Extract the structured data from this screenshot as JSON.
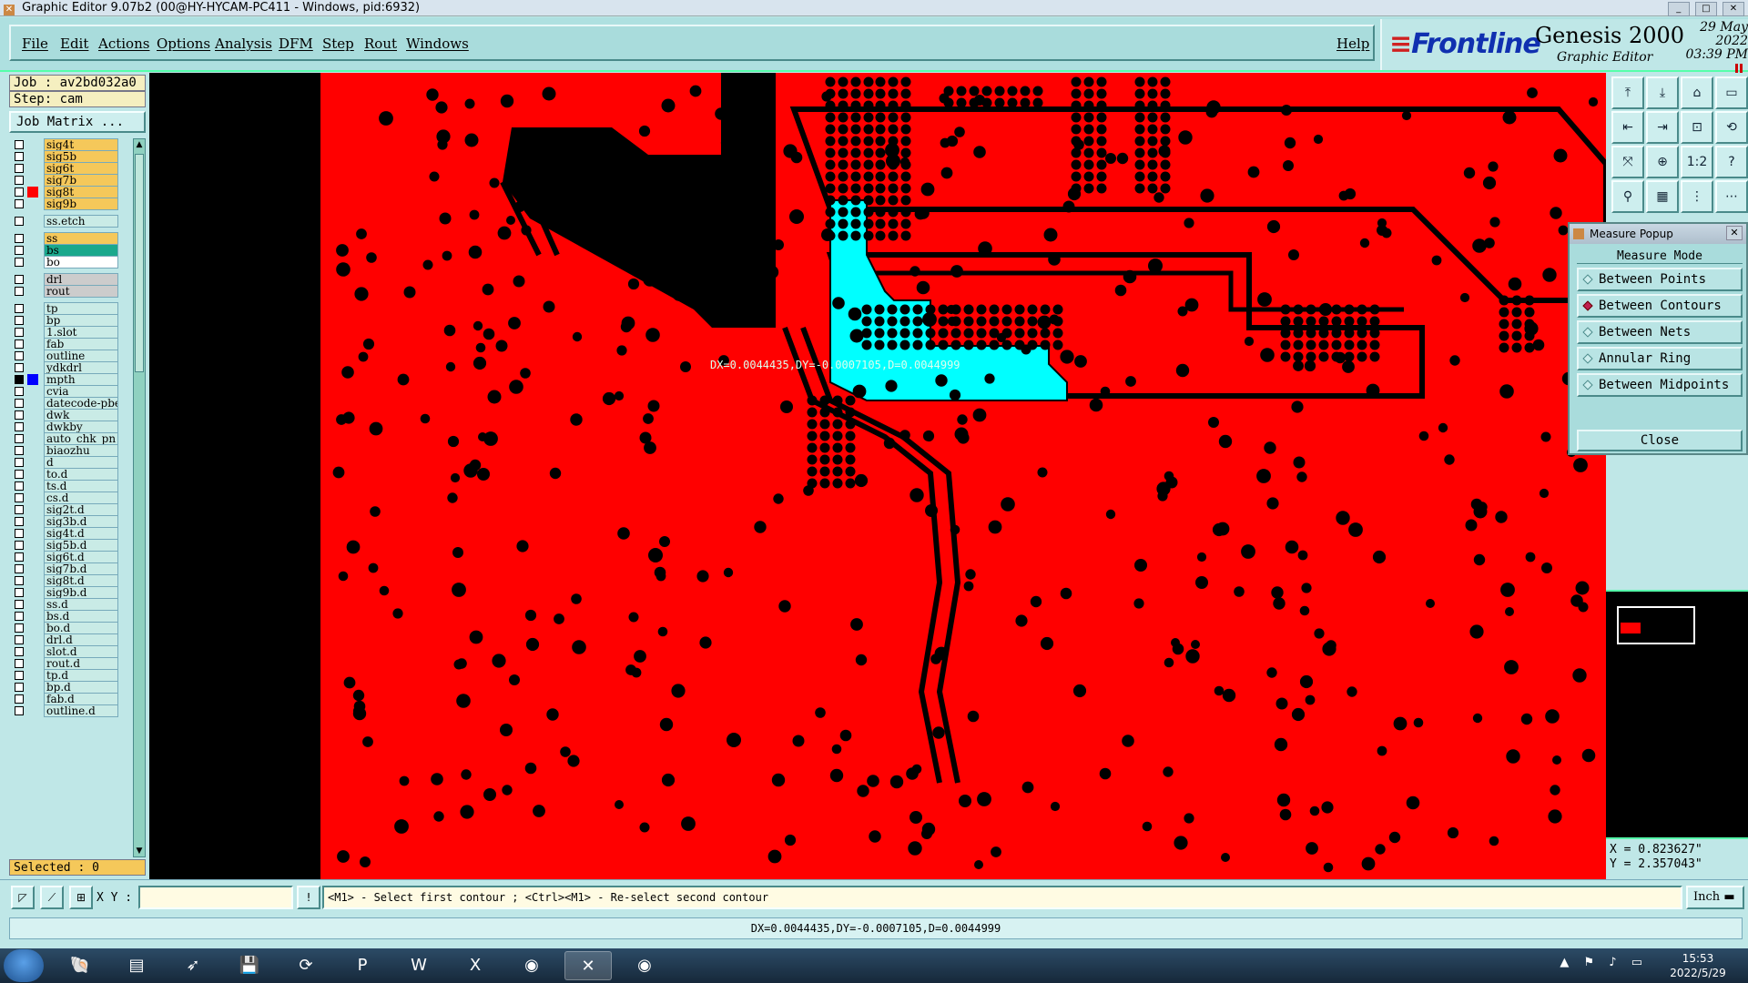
{
  "window": {
    "title": "Graphic Editor 9.07b2 (00@HY-HYCAM-PC411 - Windows, pid:6932)",
    "controls": [
      "_",
      "□",
      "✕"
    ]
  },
  "menu": {
    "items": [
      "File",
      "Edit",
      "Actions",
      "Options",
      "Analysis",
      "DFM",
      "Step",
      "Rout",
      "Windows"
    ],
    "help": "Help"
  },
  "brand": {
    "logo": "Frontline",
    "product": "Genesis 2000",
    "subtitle": "Graphic Editor",
    "date": "29 May 2022",
    "time": "03:39 PM"
  },
  "left_panel": {
    "job": "Job : av2bd032a0",
    "step": "Step: cam",
    "job_matrix": "Job Matrix ...",
    "selected": "Selected : 0"
  },
  "layers": [
    {
      "name": "sig4t",
      "style": "sig",
      "swatch": ""
    },
    {
      "name": "sig5b",
      "style": "sig",
      "swatch": ""
    },
    {
      "name": "sig6t",
      "style": "sig",
      "swatch": ""
    },
    {
      "name": "sig7b",
      "style": "sig",
      "swatch": ""
    },
    {
      "name": "sig8t",
      "style": "sig",
      "swatch": "#ff0000"
    },
    {
      "name": "sig9b",
      "style": "sig",
      "swatch": ""
    },
    {
      "name": "ss.etch",
      "style": "plain",
      "swatch": "",
      "gap": true
    },
    {
      "name": "ss",
      "style": "sig",
      "swatch": "",
      "gap": true
    },
    {
      "name": "bs",
      "style": "teal",
      "swatch": ""
    },
    {
      "name": "bo",
      "style": "white",
      "swatch": ""
    },
    {
      "name": "drl",
      "style": "grey",
      "swatch": "",
      "gap": true
    },
    {
      "name": "rout",
      "style": "grey",
      "swatch": ""
    },
    {
      "name": "tp",
      "style": "plain",
      "swatch": "",
      "gap": true
    },
    {
      "name": "bp",
      "style": "plain",
      "swatch": ""
    },
    {
      "name": "1.slot",
      "style": "plain",
      "swatch": ""
    },
    {
      "name": "fab",
      "style": "plain",
      "swatch": ""
    },
    {
      "name": "outline",
      "style": "plain",
      "swatch": ""
    },
    {
      "name": "ydkdrl",
      "style": "plain",
      "swatch": ""
    },
    {
      "name": "mpth",
      "style": "plain",
      "swatch": "#0000ff",
      "checked": true
    },
    {
      "name": "cvia",
      "style": "plain",
      "swatch": ""
    },
    {
      "name": "datecode-pbe",
      "style": "plain",
      "swatch": ""
    },
    {
      "name": "dwk",
      "style": "plain",
      "swatch": ""
    },
    {
      "name": "dwkby",
      "style": "plain",
      "swatch": ""
    },
    {
      "name": "auto_chk_pn",
      "style": "plain",
      "swatch": ""
    },
    {
      "name": "biaozhu",
      "style": "plain",
      "swatch": ""
    },
    {
      "name": "d",
      "style": "plain",
      "swatch": ""
    },
    {
      "name": "to.d",
      "style": "plain",
      "swatch": ""
    },
    {
      "name": "ts.d",
      "style": "plain",
      "swatch": ""
    },
    {
      "name": "cs.d",
      "style": "plain",
      "swatch": ""
    },
    {
      "name": "sig2t.d",
      "style": "plain",
      "swatch": ""
    },
    {
      "name": "sig3b.d",
      "style": "plain",
      "swatch": ""
    },
    {
      "name": "sig4t.d",
      "style": "plain",
      "swatch": ""
    },
    {
      "name": "sig5b.d",
      "style": "plain",
      "swatch": ""
    },
    {
      "name": "sig6t.d",
      "style": "plain",
      "swatch": ""
    },
    {
      "name": "sig7b.d",
      "style": "plain",
      "swatch": ""
    },
    {
      "name": "sig8t.d",
      "style": "plain",
      "swatch": ""
    },
    {
      "name": "sig9b.d",
      "style": "plain",
      "swatch": ""
    },
    {
      "name": "ss.d",
      "style": "plain",
      "swatch": ""
    },
    {
      "name": "bs.d",
      "style": "plain",
      "swatch": ""
    },
    {
      "name": "bo.d",
      "style": "plain",
      "swatch": ""
    },
    {
      "name": "drl.d",
      "style": "plain",
      "swatch": ""
    },
    {
      "name": "slot.d",
      "style": "plain",
      "swatch": ""
    },
    {
      "name": "rout.d",
      "style": "plain",
      "swatch": ""
    },
    {
      "name": "tp.d",
      "style": "plain",
      "swatch": ""
    },
    {
      "name": "bp.d",
      "style": "plain",
      "swatch": ""
    },
    {
      "name": "fab.d",
      "style": "plain",
      "swatch": ""
    },
    {
      "name": "outline.d",
      "style": "plain",
      "swatch": ""
    }
  ],
  "canvas": {
    "board_color": "#ff0000",
    "highlight_color": "#00ffff",
    "measure_label": "DX=0.0044435,DY=-0.0007105,D=0.0044999"
  },
  "right_tools": {
    "icons": [
      "zoom-home-icon",
      "zoom-out-icon",
      "home-icon",
      "window-icon",
      "pan-left-icon",
      "pan-right-icon",
      "zoom-area-icon",
      "redraw-icon",
      "fit-icon",
      "center-icon",
      "scale-1-2-icon",
      "help-icon",
      "snap-icon",
      "grid-icon",
      "layers-icon",
      "filter-icon"
    ],
    "scale_label": "1:2"
  },
  "measure_popup": {
    "title": "Measure Popup",
    "header": "Measure Mode",
    "options": [
      "Between Points",
      "Between Contours",
      "Between Nets",
      "Annular Ring",
      "Between Midpoints"
    ],
    "selected": "Between Contours",
    "close": "Close"
  },
  "coords": {
    "x": "X = 0.823627\"",
    "y": "Y = 2.357043\""
  },
  "bottom": {
    "xy_label": "X Y :",
    "xy_value": "",
    "prompt": "<M1> - Select first contour ; <Ctrl><M1> - Re-select second contour",
    "units": "Inch"
  },
  "status": "DX=0.0044435,DY=-0.0007105,D=0.0044999",
  "taskbar": {
    "clock_time": "15:53",
    "clock_date": "2022/5/29"
  }
}
